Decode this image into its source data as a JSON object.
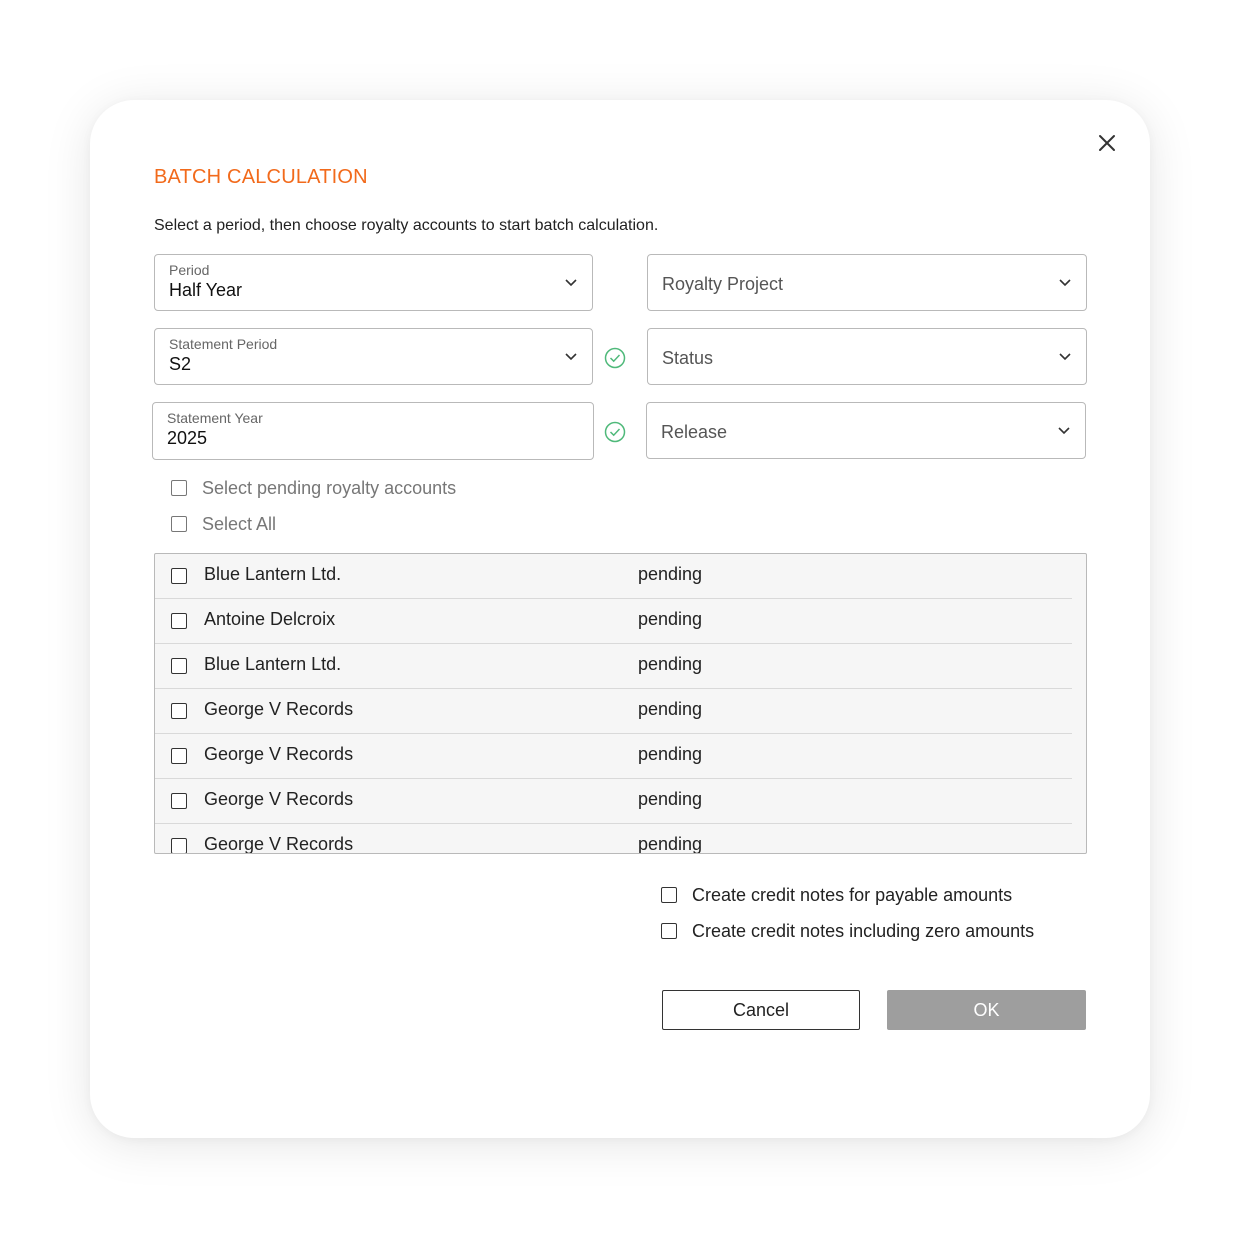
{
  "dialog": {
    "title": "BATCH CALCULATION",
    "subtitle": "Select a period, then choose royalty accounts to start batch calculation.",
    "close_icon": "close-icon",
    "accent_color": "#f26a1b"
  },
  "filters": {
    "period": {
      "label": "Period",
      "value": "Half Year"
    },
    "statement_period": {
      "label": "Statement Period",
      "value": "S2"
    },
    "statement_year": {
      "label": "Statement Year",
      "value": "2025"
    },
    "royalty_project": {
      "placeholder": "Royalty Project"
    },
    "status": {
      "placeholder": "Status"
    },
    "release": {
      "placeholder": "Release"
    }
  },
  "selection": {
    "select_pending": "Select pending royalty accounts",
    "select_all": "Select All"
  },
  "accounts": [
    {
      "name": "Blue Lantern Ltd.",
      "status": "pending"
    },
    {
      "name": "Antoine Delcroix",
      "status": "pending"
    },
    {
      "name": "Blue Lantern Ltd.",
      "status": "pending"
    },
    {
      "name": "George V Records",
      "status": "pending"
    },
    {
      "name": "George V Records",
      "status": "pending"
    },
    {
      "name": "George V Records",
      "status": "pending"
    },
    {
      "name": "George V Records",
      "status": "pending"
    }
  ],
  "options": {
    "credit_notes_payable": "Create credit notes for payable amounts",
    "credit_notes_zero": "Create credit notes including zero amounts"
  },
  "buttons": {
    "cancel": "Cancel",
    "ok": "OK"
  },
  "colors": {
    "valid_check": "#4fb97a",
    "ok_button_disabled": "#9e9e9e"
  }
}
